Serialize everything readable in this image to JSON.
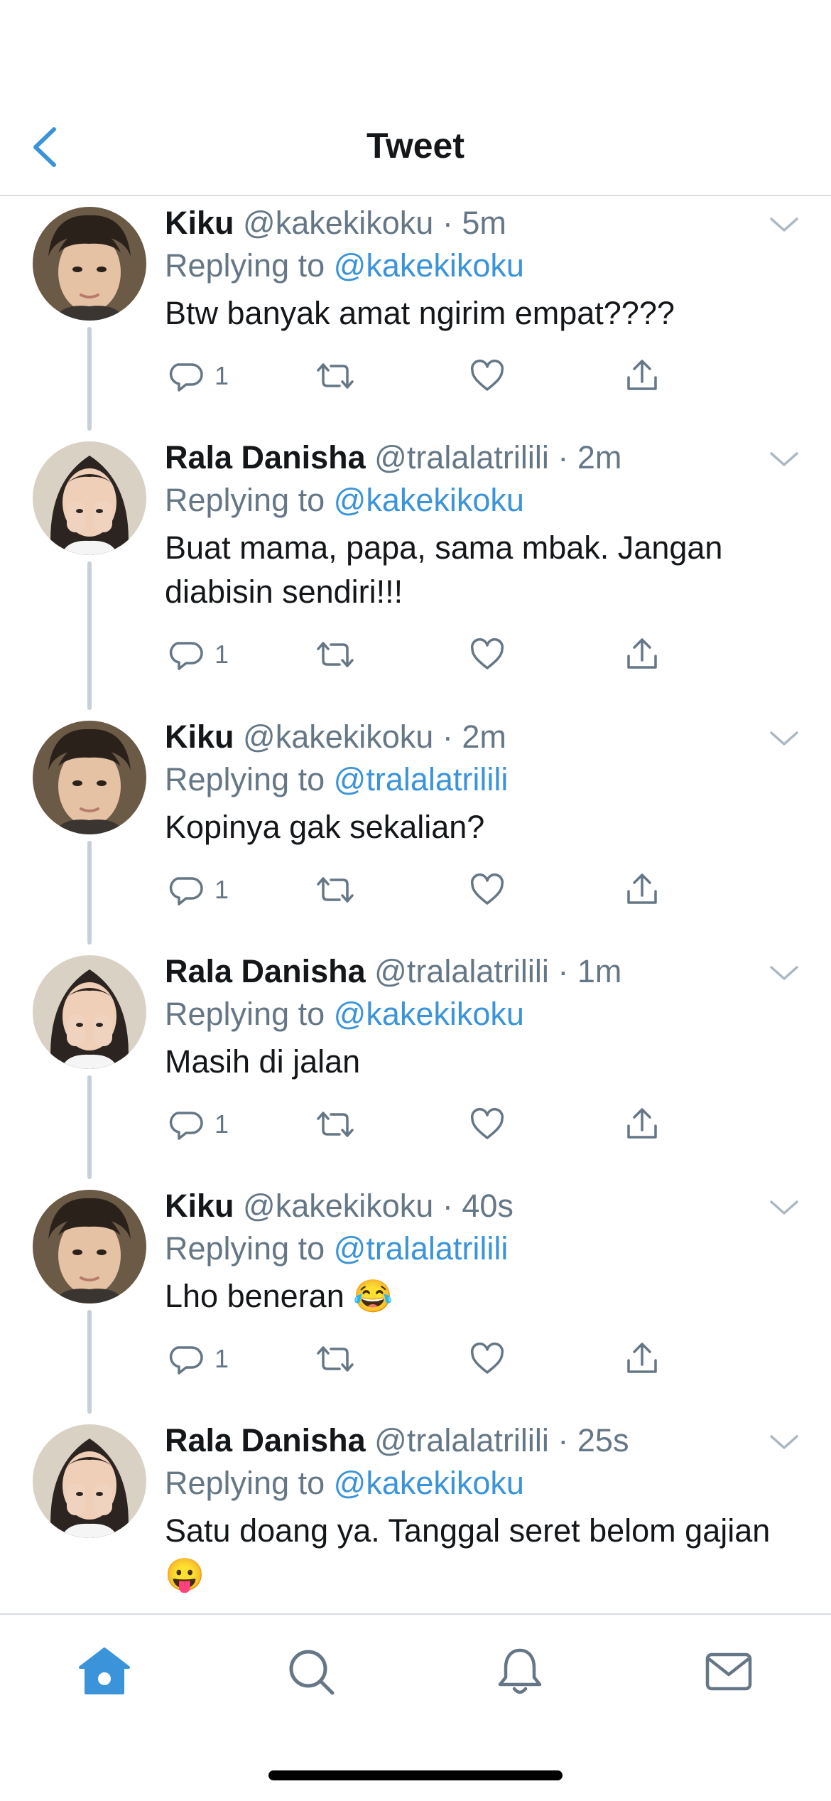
{
  "header": {
    "title": "Tweet",
    "back_icon": "chevron-left-icon"
  },
  "colors": {
    "accent": "#3b94d9",
    "secondary_text": "#657786",
    "divider": "#d9dde1",
    "thread_line": "#c6d0d8"
  },
  "tweets": [
    {
      "name": "Kiku",
      "handle": "@kakekikoku",
      "dot": "·",
      "time": "5m",
      "replying_label": "Replying to",
      "mention": "@kakekikoku",
      "text": "Btw banyak amat ngirim empat????",
      "reply_count": "1",
      "avatar": "kiku-avatar"
    },
    {
      "name": "Rala Danisha",
      "handle": "@tralalatrilili",
      "dot": "·",
      "time": "2m",
      "replying_label": "Replying to",
      "mention": "@kakekikoku",
      "text": "Buat mama, papa, sama mbak. Jangan diabisin sendiri!!!",
      "reply_count": "1",
      "avatar": "rala-avatar"
    },
    {
      "name": "Kiku",
      "handle": "@kakekikoku",
      "dot": "·",
      "time": "2m",
      "replying_label": "Replying to",
      "mention": "@tralalatrilili",
      "text": "Kopinya gak sekalian?",
      "reply_count": "1",
      "avatar": "kiku-avatar"
    },
    {
      "name": "Rala Danisha",
      "handle": "@tralalatrilili",
      "dot": "·",
      "time": "1m",
      "replying_label": "Replying to",
      "mention": "@kakekikoku",
      "text": "Masih di jalan",
      "reply_count": "1",
      "avatar": "rala-avatar"
    },
    {
      "name": "Kiku",
      "handle": "@kakekikoku",
      "dot": "·",
      "time": "40s",
      "replying_label": "Replying to",
      "mention": "@tralalatrilili",
      "text": "Lho beneran 😂",
      "reply_count": "1",
      "avatar": "kiku-avatar"
    },
    {
      "name": "Rala Danisha",
      "handle": "@tralalatrilili",
      "dot": "·",
      "time": "25s",
      "replying_label": "Replying to",
      "mention": "@kakekikoku",
      "text": "Satu doang ya. Tanggal seret belom gajian 😛",
      "reply_count": "",
      "avatar": "rala-avatar"
    }
  ],
  "tab_bar": {
    "items": [
      "home-icon",
      "search-icon",
      "notifications-icon",
      "messages-icon"
    ],
    "active": "home-icon"
  }
}
